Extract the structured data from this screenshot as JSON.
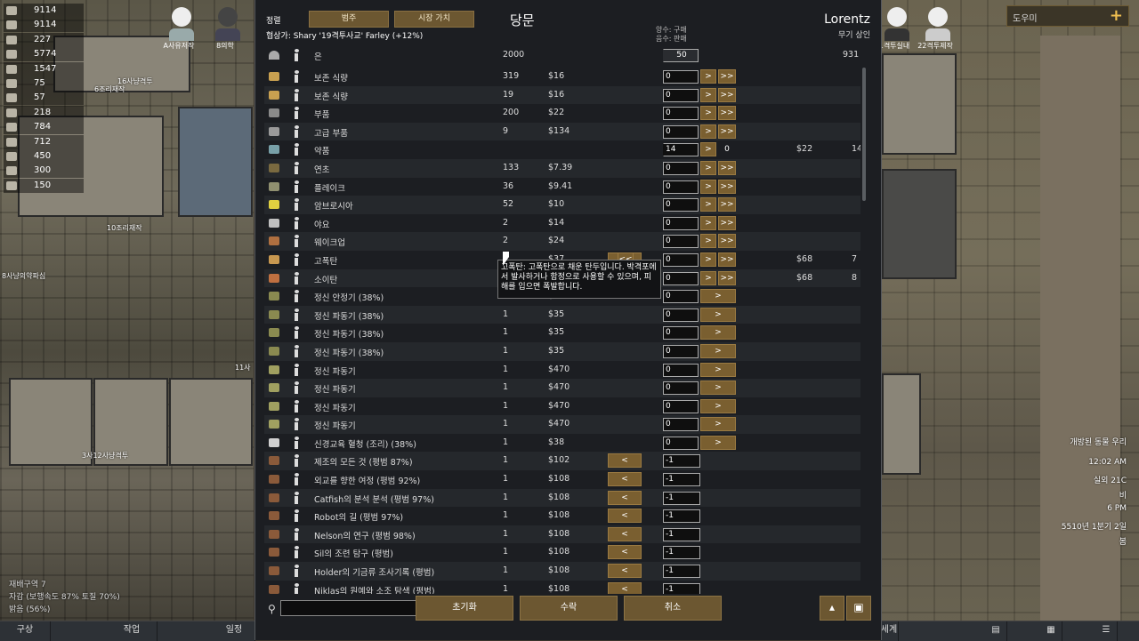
{
  "resources": [
    {
      "icon": "silver-icon",
      "value": "9114"
    },
    {
      "icon": "silver-icon",
      "value": "9114"
    },
    {
      "icon": "steel-icon",
      "value": "227"
    },
    {
      "icon": "meat-icon",
      "value": "5774"
    },
    {
      "icon": "food-icon",
      "value": "1547"
    },
    {
      "icon": "cloth-icon",
      "value": "75"
    },
    {
      "icon": "medicine-icon",
      "value": "57"
    },
    {
      "icon": "plasteel-icon",
      "value": "218"
    },
    {
      "icon": "wood-icon",
      "value": "784"
    },
    {
      "icon": "stone-icon",
      "value": "712"
    },
    {
      "icon": "stone-icon",
      "value": "450"
    },
    {
      "icon": "chunk-icon",
      "value": "300"
    },
    {
      "icon": "chunk-icon",
      "value": "150"
    }
  ],
  "colonists_left": [
    {
      "label": "A사유저작"
    },
    {
      "label": "8의학"
    }
  ],
  "colonists_right": [
    {
      "label": "1격투실내"
    },
    {
      "label": "22격투제작"
    }
  ],
  "map_labels": {
    "l1": "16사냥격투",
    "l2": "6조리재작",
    "l3": "10조리재작",
    "l4": "8사냥의약파심",
    "l5": "3사12사냥격투",
    "l6": "11사"
  },
  "status": {
    "line1": "재배구역 7",
    "line2": "자감 (보행속도 87% 토질 70%)",
    "line3": "밝음 (56%)"
  },
  "bottom_bar": {
    "arch": "구상",
    "work": "작업",
    "schedule": "일정",
    "world": "세계"
  },
  "helper": {
    "label": "도우미",
    "plus": "+"
  },
  "env": {
    "event": "개방된 동물 우리",
    "time": "12:02 AM",
    "temp": "실외 21C",
    "weather": "비",
    "hour": "6 PM",
    "date": "5510년 1분기 2일",
    "season": "봄"
  },
  "dialog": {
    "sort_label": "정렬",
    "tab_category": "범주",
    "tab_market": "시장 가치",
    "title": "당문",
    "negotiator": "협상가: Shary '19격투사교' Farley (+12%)",
    "trader_name": "Lorentz",
    "trader_kind": "무기 상인",
    "col_hint_1": "양수: 구매",
    "col_hint_2": "음수: 판매",
    "silver": {
      "name": "은",
      "colony": "2000",
      "trade": "50",
      "trader": "931"
    },
    "search_placeholder": "",
    "btn_reset": "초기화",
    "btn_accept": "수락",
    "btn_cancel": "취소",
    "tooltip": "고폭탄: 고폭탄으로 채운 탄두입니다. 박격포에서 발사하거나 함정으로 사용할 수 있으며, 피해를 입으면 폭발합니다."
  },
  "rows": [
    {
      "name": "보존 식량",
      "count": "319",
      "price": "$16",
      "trade": "0",
      "mode": "buy2",
      "icon": "meal-icon",
      "color": "#c8a050"
    },
    {
      "name": "보존 식량",
      "count": "19",
      "price": "$16",
      "trade": "0",
      "mode": "buy2",
      "icon": "meal-icon",
      "color": "#c8a050"
    },
    {
      "name": "부품",
      "count": "200",
      "price": "$22",
      "trade": "0",
      "mode": "buy2",
      "icon": "component-icon",
      "color": "#8a8a8a"
    },
    {
      "name": "고급 부품",
      "count": "9",
      "price": "$134",
      "trade": "0",
      "mode": "buy2",
      "icon": "adv-component-icon",
      "color": "#9a9a9a"
    },
    {
      "name": "약품",
      "count": "",
      "price": "",
      "trade": "14",
      "mode": "buy0",
      "icon": "medicine-icon",
      "color": "#78a0a8",
      "tprice": "$22",
      "tcount": "14"
    },
    {
      "name": "연초",
      "count": "133",
      "price": "$7.39",
      "trade": "0",
      "mode": "buy2",
      "icon": "smokeleaf-icon",
      "color": "#7a6a40"
    },
    {
      "name": "플레이크",
      "count": "36",
      "price": "$9.41",
      "trade": "0",
      "mode": "buy2",
      "icon": "flake-icon",
      "color": "#909070"
    },
    {
      "name": "암브로시아",
      "count": "52",
      "price": "$10",
      "trade": "0",
      "mode": "buy2",
      "icon": "ambrosia-icon",
      "color": "#e0d040"
    },
    {
      "name": "야요",
      "count": "2",
      "price": "$14",
      "trade": "0",
      "mode": "buy2",
      "icon": "yayo-icon",
      "color": "#c0c0c0"
    },
    {
      "name": "웨이크업",
      "count": "2",
      "price": "$24",
      "trade": "0",
      "mode": "buy2",
      "icon": "wakeup-icon",
      "color": "#b07040"
    },
    {
      "name": "고폭탄",
      "count": "",
      "price": "$37",
      "trade": "0",
      "mode": "both",
      "icon": "shell-icon",
      "color": "#c89850",
      "tprice": "$68",
      "tcount": "7"
    },
    {
      "name": "소이탄",
      "count": "",
      "price": "",
      "trade": "0",
      "mode": "buy2",
      "icon": "incendiary-shell-icon",
      "color": "#c07040",
      "tprice": "$68",
      "tcount": "8"
    },
    {
      "name": "정신 안정기 (38%)",
      "count": "1",
      "price": "$35",
      "trade": "0",
      "mode": "buy1",
      "icon": "psychic-soother-icon",
      "color": "#8a8a50"
    },
    {
      "name": "정신 파동기 (38%)",
      "count": "1",
      "price": "$35",
      "trade": "0",
      "mode": "buy1",
      "icon": "crown-icon",
      "color": "#8a8a50"
    },
    {
      "name": "정신 파동기 (38%)",
      "count": "1",
      "price": "$35",
      "trade": "0",
      "mode": "buy1",
      "icon": "crown-icon",
      "color": "#8a8a50"
    },
    {
      "name": "정신 파동기 (38%)",
      "count": "1",
      "price": "$35",
      "trade": "0",
      "mode": "buy1",
      "icon": "crown-icon",
      "color": "#8a8a50"
    },
    {
      "name": "정신 파동기",
      "count": "1",
      "price": "$470",
      "trade": "0",
      "mode": "buy1",
      "icon": "crown-icon",
      "color": "#a0a060"
    },
    {
      "name": "정신 파동기",
      "count": "1",
      "price": "$470",
      "trade": "0",
      "mode": "buy1",
      "icon": "crown-icon",
      "color": "#a0a060"
    },
    {
      "name": "정신 파동기",
      "count": "1",
      "price": "$470",
      "trade": "0",
      "mode": "buy1",
      "icon": "crown-icon",
      "color": "#a0a060"
    },
    {
      "name": "정신 파동기",
      "count": "1",
      "price": "$470",
      "trade": "0",
      "mode": "buy1",
      "icon": "crown-icon",
      "color": "#a0a060"
    },
    {
      "name": "신경교육 혈청 (조리) (38%)",
      "count": "1",
      "price": "$38",
      "trade": "0",
      "mode": "buy1",
      "icon": "serum-icon",
      "color": "#d0d0d0"
    },
    {
      "name": "제조의 모든 것 (평범 87%)",
      "count": "1",
      "price": "$102",
      "trade": "-1",
      "mode": "sell",
      "icon": "book-icon",
      "color": "#8a5a3a"
    },
    {
      "name": "외교를 향한 여정 (평범 92%)",
      "count": "1",
      "price": "$108",
      "trade": "-1",
      "mode": "sell",
      "icon": "book-icon",
      "color": "#8a5a3a"
    },
    {
      "name": "Catfish의 분석 분석 (평범 97%)",
      "count": "1",
      "price": "$108",
      "trade": "-1",
      "mode": "sell",
      "icon": "book-icon",
      "color": "#8a5a3a"
    },
    {
      "name": "Robot의 길 (평범 97%)",
      "count": "1",
      "price": "$108",
      "trade": "-1",
      "mode": "sell",
      "icon": "book-icon",
      "color": "#8a5a3a"
    },
    {
      "name": "Nelson의 연구 (평범 98%)",
      "count": "1",
      "price": "$108",
      "trade": "-1",
      "mode": "sell",
      "icon": "book-icon",
      "color": "#8a5a3a"
    },
    {
      "name": "Sil의 조련 탐구 (평범)",
      "count": "1",
      "price": "$108",
      "trade": "-1",
      "mode": "sell",
      "icon": "book-icon",
      "color": "#8a5a3a"
    },
    {
      "name": "Holder의 기금류 조사기록 (평범)",
      "count": "1",
      "price": "$108",
      "trade": "-1",
      "mode": "sell",
      "icon": "book-icon",
      "color": "#8a5a3a"
    },
    {
      "name": "Niklas의 원예와 소조 탐색 (평범)",
      "count": "1",
      "price": "$108",
      "trade": "-1",
      "mode": "sell",
      "icon": "book-icon",
      "color": "#8a5a3a"
    }
  ],
  "labels": {
    "buy": ">",
    "buy_all": ">>",
    "sell": "<",
    "sell_all": "<<",
    "zero": "0"
  }
}
